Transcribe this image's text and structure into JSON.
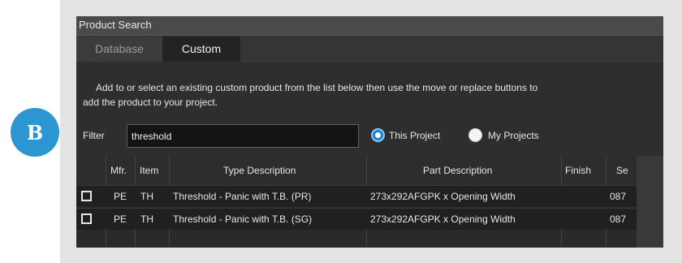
{
  "badge": {
    "letter": "B"
  },
  "window": {
    "title": "Product Search",
    "tabs": [
      {
        "label": "Database",
        "active": false
      },
      {
        "label": "Custom",
        "active": true
      }
    ]
  },
  "instructions": {
    "line1": "Add to or select an existing custom product from the list below then use the move or replace buttons to",
    "line2": "add the product to your project."
  },
  "filter": {
    "label": "Filter",
    "value": "threshold"
  },
  "scope": {
    "options": [
      {
        "label": "This Project",
        "selected": true
      },
      {
        "label": "My Projects",
        "selected": false
      }
    ]
  },
  "table": {
    "columns": [
      "Mfr.",
      "Item",
      "Type Description",
      "Part Description",
      "Finish",
      "Se"
    ],
    "rows": [
      {
        "checked": false,
        "mfr": "PE",
        "item": "TH",
        "type": "Threshold - Panic with T.B. (PR)",
        "part": "273x292AFGPK x Opening Width",
        "finish": "",
        "se": "087"
      },
      {
        "checked": false,
        "mfr": "PE",
        "item": "TH",
        "type": "Threshold - Panic with T.B. (SG)",
        "part": "273x292AFGPK x Opening Width",
        "finish": "",
        "se": "087"
      }
    ]
  },
  "colors": {
    "badge": "#2b96d2",
    "window_bg": "#2e2e2e",
    "radio_selected": "#1c7fd6"
  }
}
